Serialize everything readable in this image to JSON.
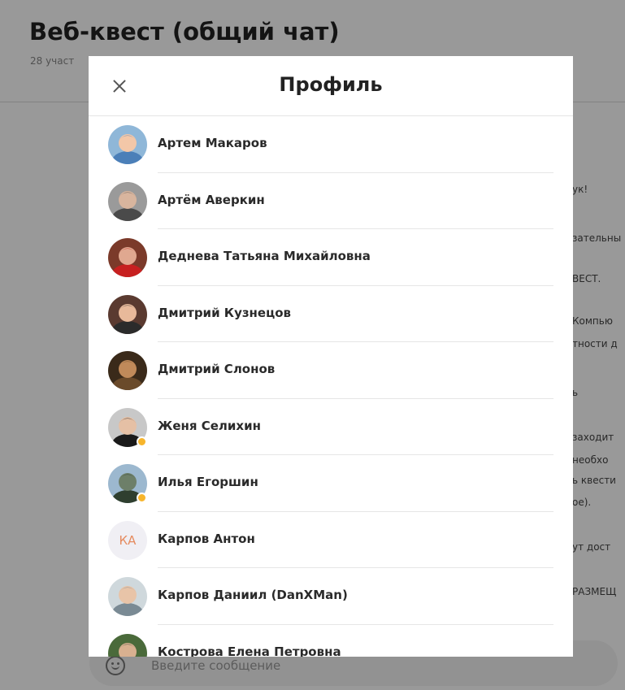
{
  "chat": {
    "title": "Веб-квест (общий чат)",
    "subtitle": "28 участ",
    "message_fragments": [
      "ук!",
      "зательны",
      "ВЕСТ.",
      "Компью",
      "тности д",
      "ь",
      "заходит",
      "необхо",
      "ь квести",
      "ое).",
      "ут дост",
      "РАЗМЕЩ"
    ],
    "composer_placeholder": "Введите сообщение"
  },
  "modal": {
    "title": "Профиль",
    "members": [
      {
        "name": "Артем Макаров",
        "avatar": "photo",
        "colors": [
          "#8fb7d8",
          "#f3c7a8",
          "#4b7fb8"
        ],
        "badge": false
      },
      {
        "name": "Артём Аверкин",
        "avatar": "photo",
        "colors": [
          "#9a9a9a",
          "#d8b59e",
          "#4a4a4a"
        ],
        "badge": false
      },
      {
        "name": "Деднева Татьяна Михайловна",
        "avatar": "photo",
        "colors": [
          "#7b3a2a",
          "#e0a890",
          "#c72020"
        ],
        "badge": false
      },
      {
        "name": "Дмитрий Кузнецов",
        "avatar": "photo",
        "colors": [
          "#5a3a30",
          "#e8b99a",
          "#2b2b2b"
        ],
        "badge": false
      },
      {
        "name": "Дмитрий Слонов",
        "avatar": "photo",
        "colors": [
          "#3a2a1a",
          "#c08a5a",
          "#6a4a2a"
        ],
        "badge": false
      },
      {
        "name": "Женя Селихин",
        "avatar": "photo",
        "colors": [
          "#c8c8c8",
          "#e5c0a5",
          "#1a1a1a"
        ],
        "badge": true
      },
      {
        "name": "Илья Егоршин",
        "avatar": "photo",
        "colors": [
          "#9cb8cf",
          "#6d7f69",
          "#2f3f2f"
        ],
        "badge": true
      },
      {
        "name": "Карпов Антон",
        "avatar": "initials",
        "initials": "КА",
        "badge": false
      },
      {
        "name": "Карпов Даниил (DanXMan)",
        "avatar": "photo",
        "colors": [
          "#cfd8dc",
          "#e8c4a8",
          "#7a8a94"
        ],
        "badge": false
      },
      {
        "name": "Кострова Елена Петровна",
        "avatar": "photo",
        "colors": [
          "#4a6a3a",
          "#d8b090",
          "#2a3a2a"
        ],
        "badge": false
      }
    ]
  }
}
